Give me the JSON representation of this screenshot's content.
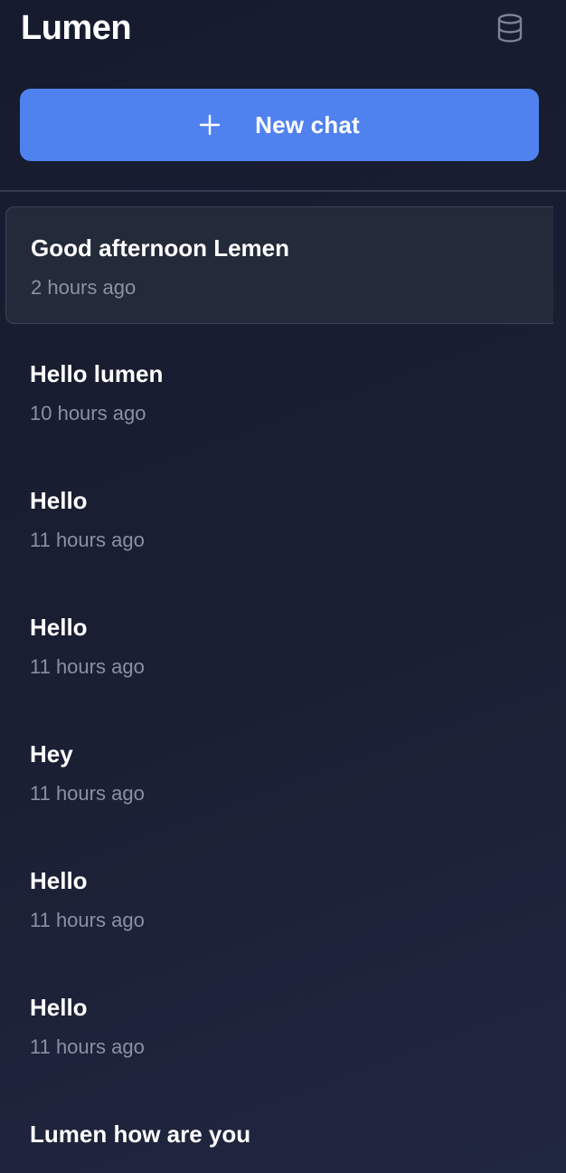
{
  "app": {
    "title": "Lumen"
  },
  "header": {
    "database_icon": "database-icon"
  },
  "new_chat": {
    "label": "New chat",
    "icon": "plus-icon",
    "color": "#5082ef"
  },
  "chats": [
    {
      "title": "Good afternoon Lemen",
      "time": "2 hours ago",
      "active": true
    },
    {
      "title": "Hello lumen",
      "time": "10 hours ago",
      "active": false
    },
    {
      "title": "Hello",
      "time": "11 hours ago",
      "active": false
    },
    {
      "title": "Hello",
      "time": "11 hours ago",
      "active": false
    },
    {
      "title": "Hey",
      "time": "11 hours ago",
      "active": false
    },
    {
      "title": "Hello",
      "time": "11 hours ago",
      "active": false
    },
    {
      "title": "Hello",
      "time": "11 hours ago",
      "active": false
    },
    {
      "title": "Lumen how are you",
      "time": "",
      "active": false
    }
  ]
}
